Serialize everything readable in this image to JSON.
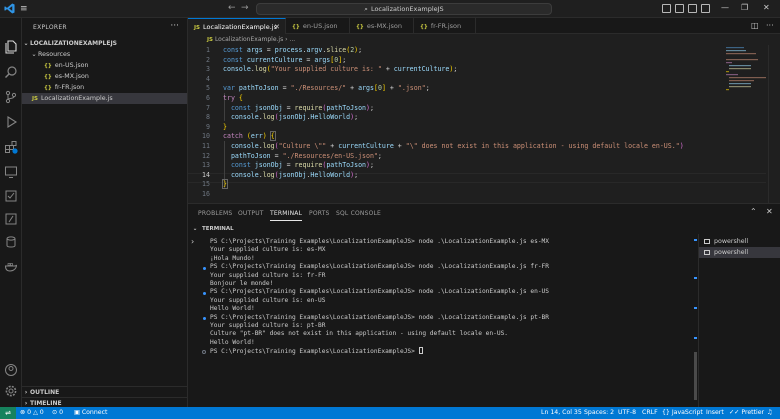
{
  "titlebar": {
    "search_text": "LocalizationExampleJS",
    "menu_icon": "hamburger-menu-icon",
    "back_icon": "arrow-left-icon",
    "forward_icon": "arrow-right-icon"
  },
  "sidebar": {
    "title": "EXPLORER",
    "project": "LOCALIZATIONEXAMPLEJS",
    "folder": "Resources",
    "files": [
      "en-US.json",
      "es-MX.json",
      "fr-FR.json"
    ],
    "main_file": "LocalizationExample.js",
    "outline": "OUTLINE",
    "timeline": "TIMELINE"
  },
  "tabs": [
    {
      "label": "LocalizationExample.js",
      "icon": "JS"
    },
    {
      "label": "en-US.json",
      "icon": "{}"
    },
    {
      "label": "es-MX.json",
      "icon": "{}"
    },
    {
      "label": "fr-FR.json",
      "icon": "{}"
    }
  ],
  "breadcrumb": {
    "icon": "JS",
    "file": "LocalizationExample.js",
    "sep": "›",
    "symbol": "..."
  },
  "editor": {
    "line_numbers": [
      "1",
      "2",
      "3",
      "4",
      "5",
      "6",
      "7",
      "8",
      "9",
      "10",
      "11",
      "12",
      "13",
      "14",
      "15",
      "16"
    ],
    "current_line": "14"
  },
  "panel": {
    "tabs": [
      "PROBLEMS",
      "OUTPUT",
      "TERMINAL",
      "PORTS",
      "SQL CONSOLE"
    ],
    "active_tab": "TERMINAL",
    "section": "TERMINAL",
    "terminal_lines": [
      "PS C:\\Projects\\Training Examples\\LocalizationExampleJS> node .\\LocalizationExample.js es-MX",
      "Your supplied culture is: es-MX",
      "¡Hola Mundo!",
      "PS C:\\Projects\\Training Examples\\LocalizationExampleJS> node .\\LocalizationExample.js fr-FR",
      "Your supplied culture is: fr-FR",
      "Bonjour le monde!",
      "PS C:\\Projects\\Training Examples\\LocalizationExampleJS> node .\\LocalizationExample.js en-US",
      "Your supplied culture is: en-US",
      "Hello World!",
      "PS C:\\Projects\\Training Examples\\LocalizationExampleJS> node .\\LocalizationExample.js pt-BR",
      "Your supplied culture is: pt-BR",
      "Culture \"pt-BR\" does not exist in this application - using default locale en-US.",
      "Hello World!",
      "PS C:\\Projects\\Training Examples\\LocalizationExampleJS> "
    ],
    "terminals": [
      "powershell",
      "powershell"
    ]
  },
  "status": {
    "errors": "0",
    "warnings": "0",
    "ports": "0",
    "connect": "Connect",
    "position": "Ln 14, Col 35",
    "spaces": "Spaces: 2",
    "encoding": "UTF-8",
    "eol": "CRLF",
    "language": "JavaScript",
    "insert": "Insert",
    "prettier": "Prettier",
    "accent": "#0078d4"
  }
}
